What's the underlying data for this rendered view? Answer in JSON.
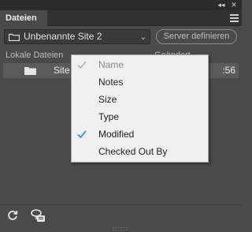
{
  "panel": {
    "tab_label": "Dateien",
    "collapse_glyph": "◂◂",
    "close_glyph": "✕",
    "menu_icon": "hamburger-icon"
  },
  "site_bar": {
    "site_name": "Unbenannte Site 2",
    "server_button_label": "Server definieren"
  },
  "columns": {
    "local_files": "Lokale Dateien",
    "changed": "Geändert"
  },
  "files": [
    {
      "name": "Site",
      "time": ":56",
      "icon": "folder-icon"
    }
  ],
  "context_menu": {
    "items": [
      {
        "label": "Name",
        "checked": true,
        "disabled": true
      },
      {
        "label": "Notes",
        "checked": false,
        "disabled": false
      },
      {
        "label": "Size",
        "checked": false,
        "disabled": false
      },
      {
        "label": "Type",
        "checked": false,
        "disabled": false
      },
      {
        "label": "Modified",
        "checked": true,
        "disabled": false
      },
      {
        "label": "Checked Out By",
        "checked": false,
        "disabled": false
      }
    ]
  },
  "toolbar": {
    "refresh_icon": "refresh-icon",
    "log_icon": "log-icon"
  },
  "colors": {
    "panel_bg": "#4a4a4a",
    "menu_bg": "#f0f0f0",
    "check_active": "#3d8ee6",
    "check_disabled": "#9a9a9a"
  }
}
